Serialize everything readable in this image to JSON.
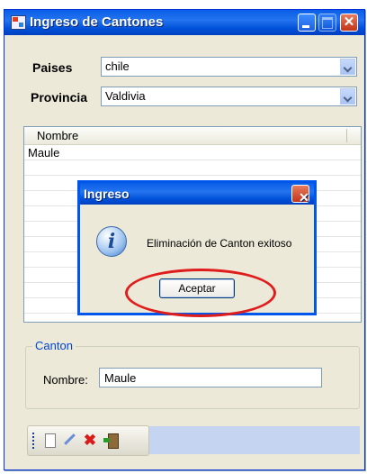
{
  "window": {
    "title": "Ingreso de Cantones"
  },
  "filters": {
    "paises_label": "Paises",
    "paises_value": "chile",
    "provincia_label": "Provincia",
    "provincia_value": "Valdivia"
  },
  "grid": {
    "columns": [
      "Nombre"
    ],
    "rows": [
      [
        "Maule"
      ]
    ]
  },
  "dialog": {
    "title": "Ingreso",
    "icon": "info-icon",
    "message": "Eliminación de Canton exitoso",
    "button_label": "Aceptar"
  },
  "canton_group": {
    "title": "Canton",
    "nombre_label": "Nombre:",
    "nombre_value": "Maule"
  },
  "toolbar": {
    "icons": [
      "new-icon",
      "edit-icon",
      "delete-icon",
      "exit-icon"
    ]
  },
  "colors": {
    "title_bar": "#0a5ee6",
    "window_bg": "#ece9d8",
    "highlight": "#e01d1d",
    "group_title": "#0046d5"
  }
}
